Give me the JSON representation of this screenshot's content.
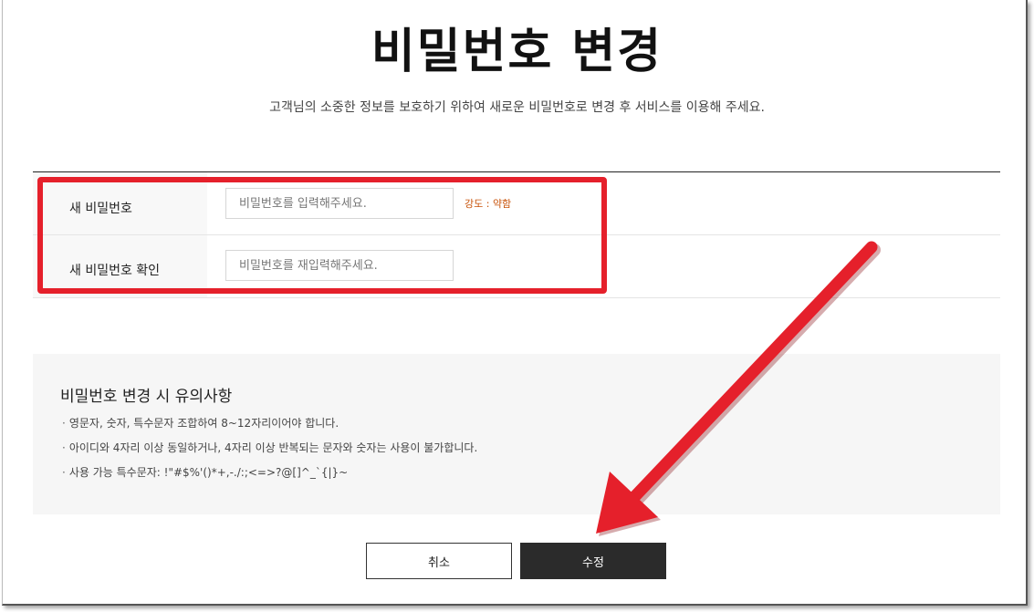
{
  "page": {
    "title": "비밀번호 변경",
    "description": "고객님의 소중한 정보를 보호하기 위하여 새로운 비밀번호로 변경 후 서비스를 이용해 주세요."
  },
  "form": {
    "new_password": {
      "label": "새 비밀번호",
      "placeholder": "비밀번호를 입력해주세요.",
      "value": "",
      "strength": "강도 : 약함"
    },
    "confirm_password": {
      "label": "새 비밀번호 확인",
      "placeholder": "비밀번호를 재입력해주세요.",
      "value": ""
    }
  },
  "notice": {
    "title": "비밀번호 변경 시 유의사항",
    "bullet": "·",
    "items": [
      "영문자, 숫자, 특수문자 조합하여 8~12자리이어야 합니다.",
      "아이디와 4자리 이상 동일하거나, 4자리 이상 반복되는 문자와 숫자는 사용이 불가합니다.",
      "사용 가능 특수문자: !\"#$%'()*+,-./:;<=>?@[]^_`{|}~"
    ]
  },
  "buttons": {
    "cancel": "취소",
    "submit": "수정"
  },
  "colors": {
    "annotation_red": "#e5202b",
    "strength_orange": "#c8530a",
    "submit_bg": "#2b2b2b"
  }
}
